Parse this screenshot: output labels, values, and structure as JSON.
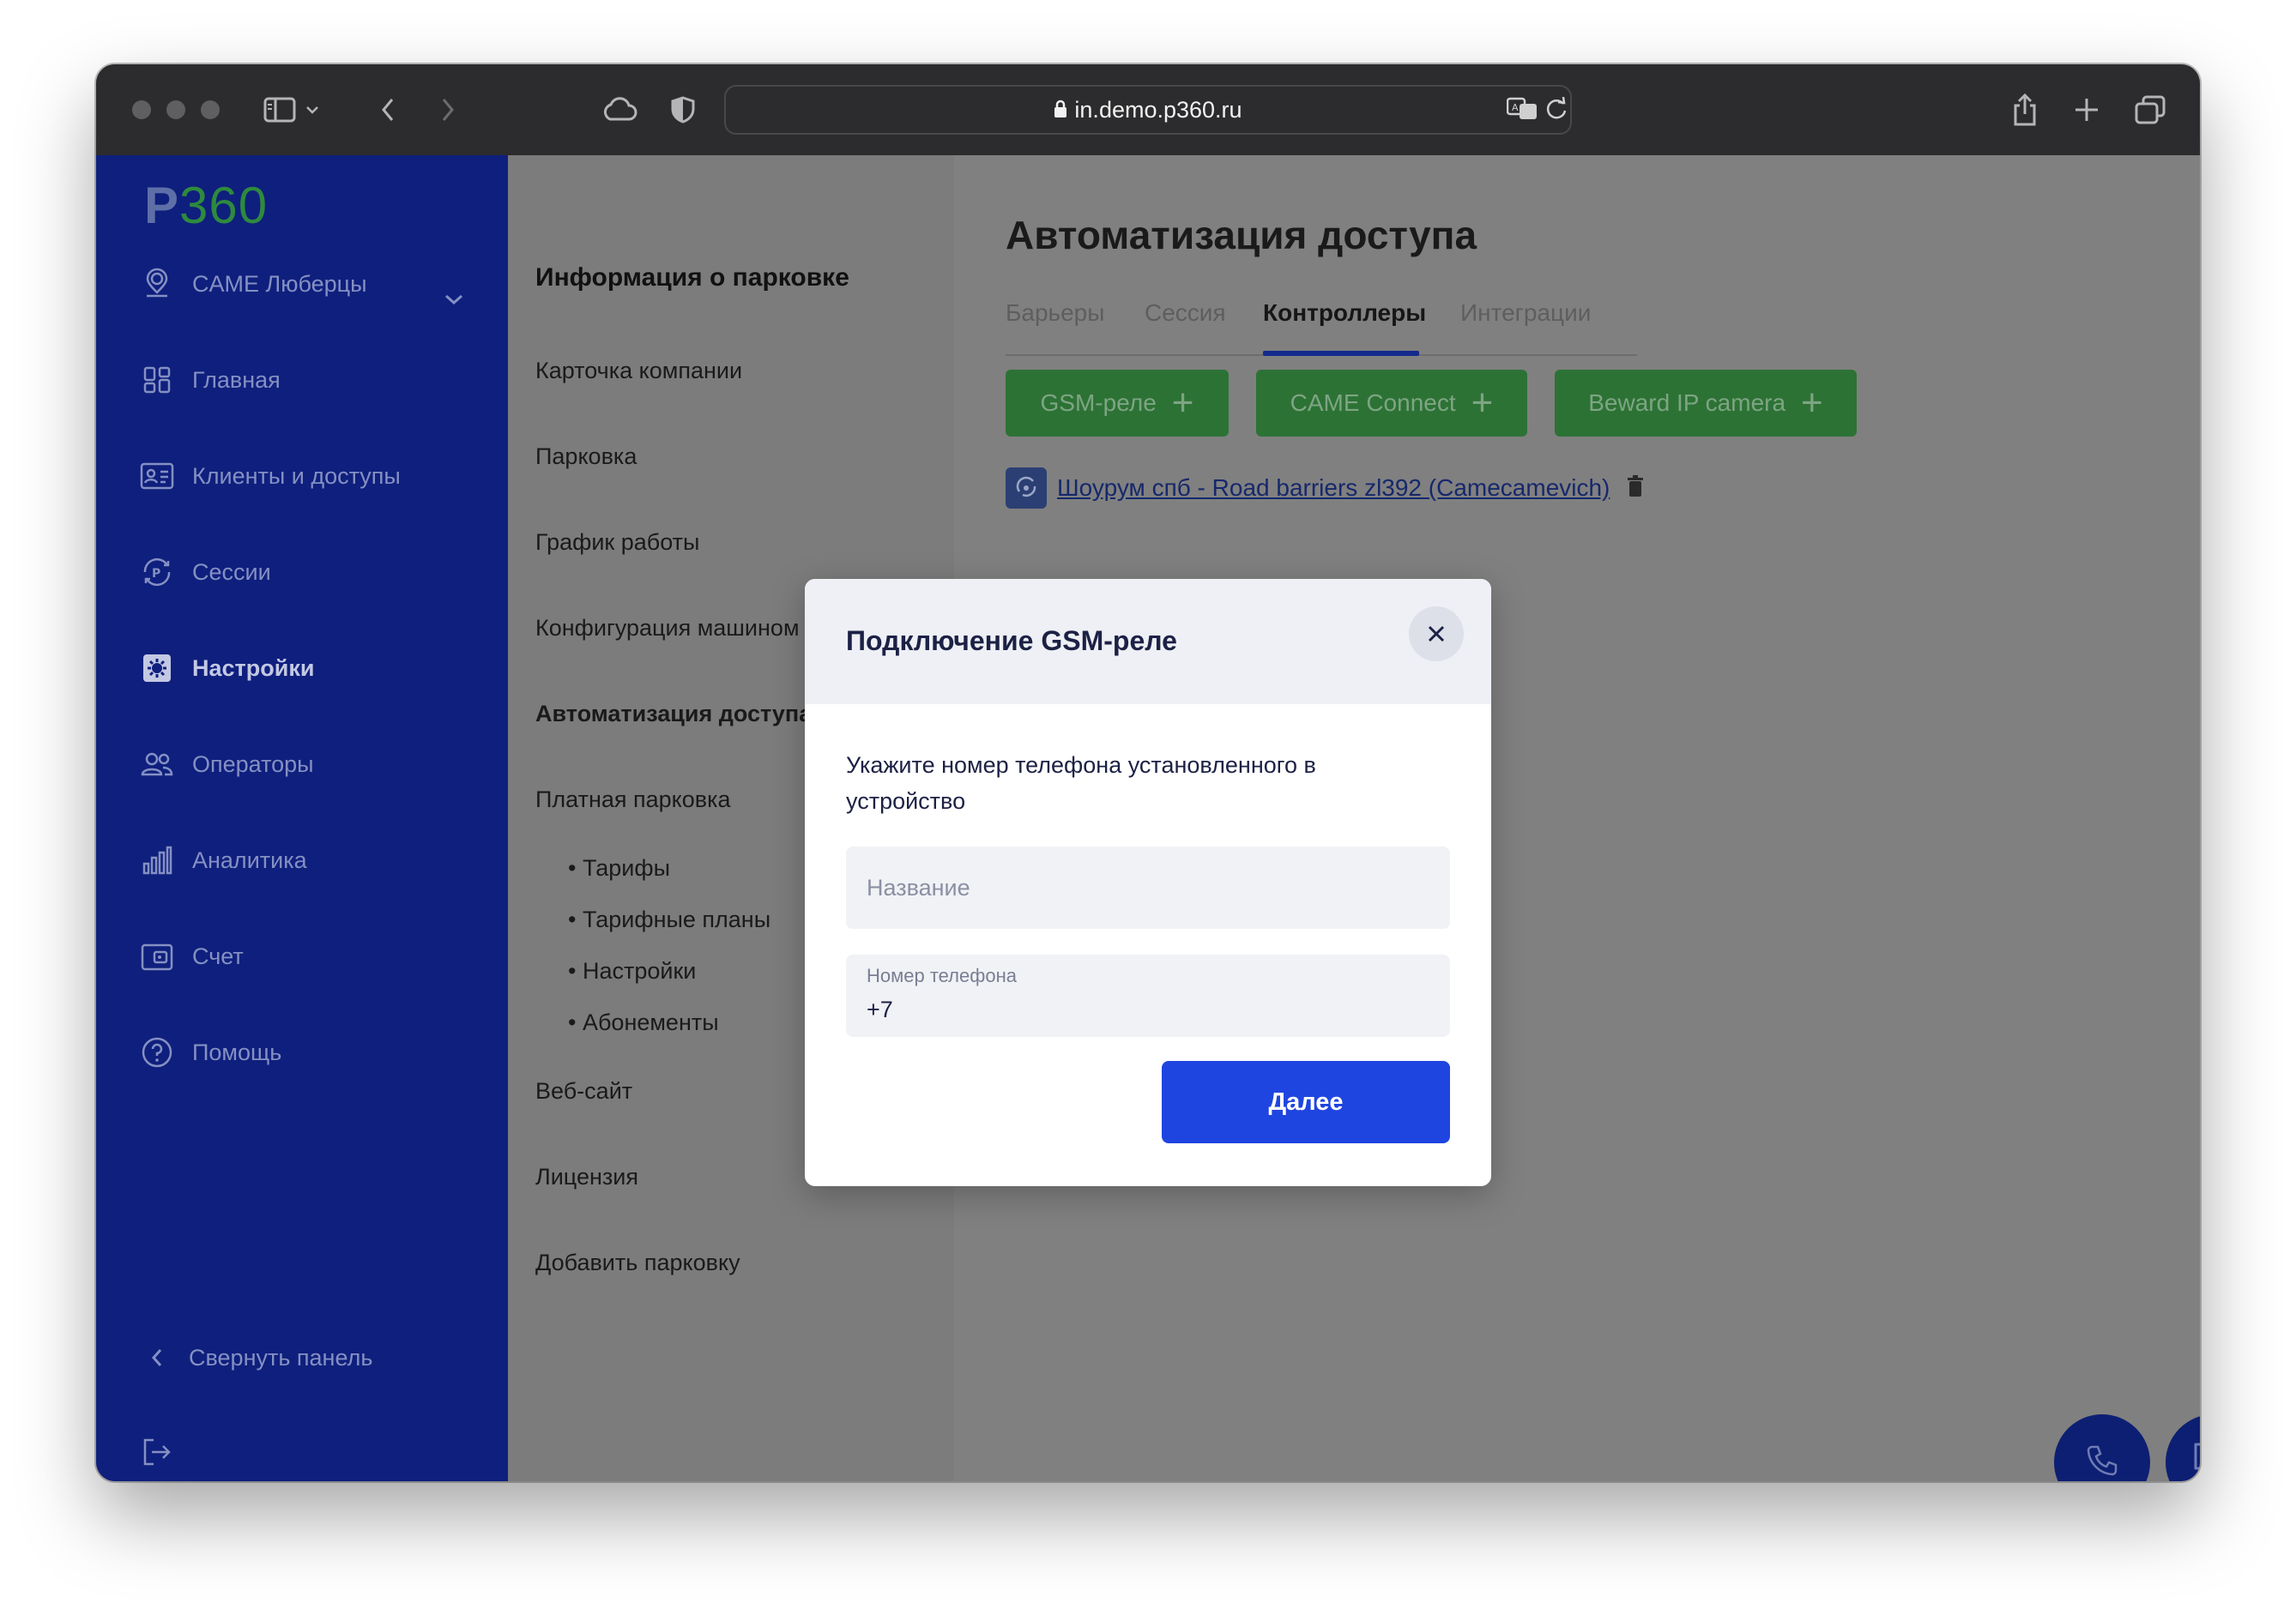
{
  "browser": {
    "url": "in.demo.p360.ru"
  },
  "sidebar": {
    "logo_p": "P",
    "logo_num": "360",
    "location": "CAME Люберцы",
    "items": [
      {
        "label": "Главная",
        "icon": "dashboard-icon"
      },
      {
        "label": "Клиенты и доступы",
        "icon": "id-card-icon"
      },
      {
        "label": "Сессии",
        "icon": "parking-session-icon"
      },
      {
        "label": "Настройки",
        "icon": "settings-icon"
      },
      {
        "label": "Операторы",
        "icon": "users-icon"
      },
      {
        "label": "Аналитика",
        "icon": "bar-chart-icon"
      },
      {
        "label": "Счет",
        "icon": "wallet-icon"
      },
      {
        "label": "Помощь",
        "icon": "help-icon"
      }
    ],
    "collapse_label": "Свернуть панель"
  },
  "settings_menu": {
    "heading": "Информация о парковке",
    "items": [
      "Карточка компании",
      "Парковка",
      "График работы",
      "Конфигурация машином",
      "Автоматизация доступа",
      "Платная парковка"
    ],
    "sub_items": [
      "• Тарифы",
      "• Тарифные планы",
      "• Настройки",
      "• Абонементы"
    ],
    "items_after": [
      "Веб-сайт",
      "Лицензия",
      "Добавить парковку"
    ]
  },
  "main": {
    "title": "Автоматизация доступа",
    "tabs": [
      "Барьеры",
      "Сессия",
      "Контроллеры",
      "Интеграции"
    ],
    "active_tab": "Контроллеры",
    "add_buttons": [
      "GSM-реле",
      "CAME Connect",
      "Beward IP camera"
    ],
    "device_link": "Шоурум спб - Road barriers zl392 (Camecamevich)"
  },
  "modal": {
    "title": "Подключение GSM-реле",
    "description": "Укажите номер телефона установленного в устройство",
    "name_placeholder": "Название",
    "phone_label": "Номер телефона",
    "phone_value": "+7",
    "submit_label": "Далее"
  },
  "colors": {
    "sidebar_bg": "#0f1f7d",
    "accent_green": "#2d7235",
    "primary_blue": "#1f45e0",
    "overlay": "#808080"
  }
}
